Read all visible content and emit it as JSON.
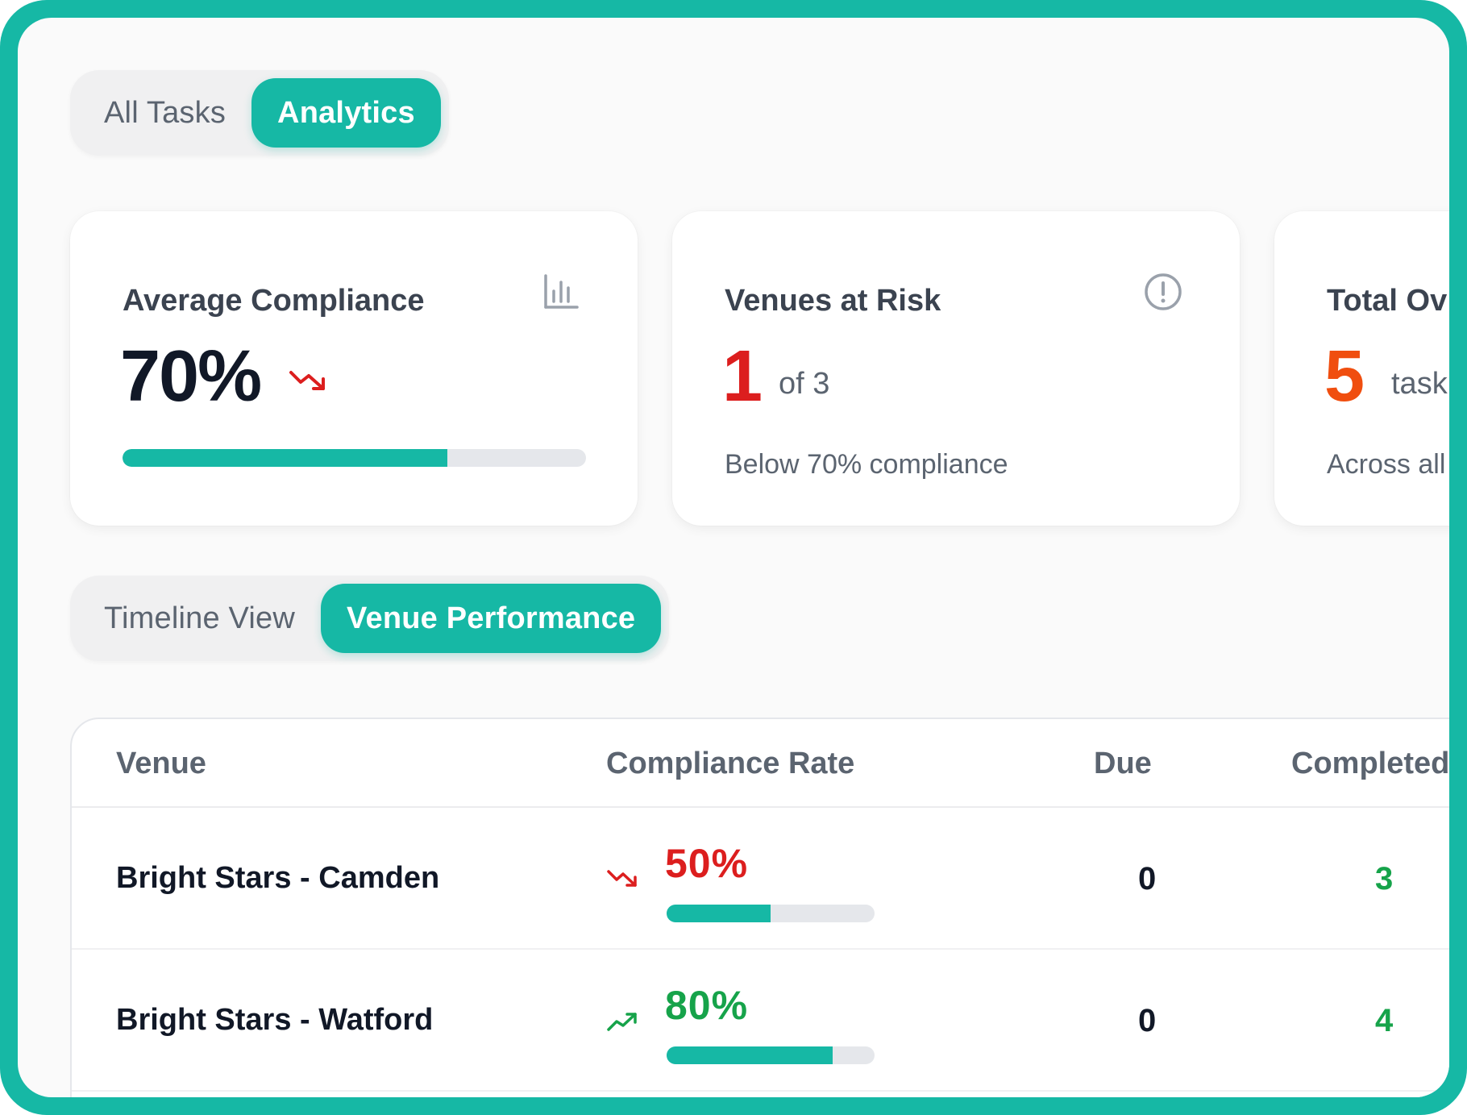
{
  "tabs_top": {
    "all_tasks": "All Tasks",
    "analytics": "Analytics",
    "active": "Analytics"
  },
  "cards": {
    "average_compliance": {
      "title": "Average Compliance",
      "value": "70%",
      "progress_fraction": 0.7,
      "trend": "down",
      "icon": "bar-chart-icon"
    },
    "venues_at_risk": {
      "title": "Venues at Risk",
      "value": "1",
      "of_text": "of 3",
      "subtitle": "Below 70% compliance",
      "icon": "alert-circle-icon"
    },
    "total_overdue": {
      "title": "Total Ov",
      "value": "5",
      "unit_text": "task",
      "subtitle": "Across all"
    }
  },
  "tabs_view": {
    "timeline": "Timeline View",
    "venue_performance": "Venue Performance",
    "active": "Venue Performance"
  },
  "table": {
    "headers": {
      "venue": "Venue",
      "compliance_rate": "Compliance Rate",
      "due": "Due",
      "completed": "Completed"
    },
    "rows": [
      {
        "venue": "Bright Stars - Camden",
        "rate": "50%",
        "rate_fraction": 0.5,
        "trend": "down",
        "due": "0",
        "completed": "3"
      },
      {
        "venue": "Bright Stars - Watford",
        "rate": "80%",
        "rate_fraction": 0.8,
        "trend": "up",
        "due": "0",
        "completed": "4"
      }
    ]
  },
  "colors": {
    "accent": "#16b8a5",
    "danger": "#dc1e1e",
    "warning": "#f04e0f",
    "success": "#16a34a",
    "muted_text": "#5b6470"
  }
}
